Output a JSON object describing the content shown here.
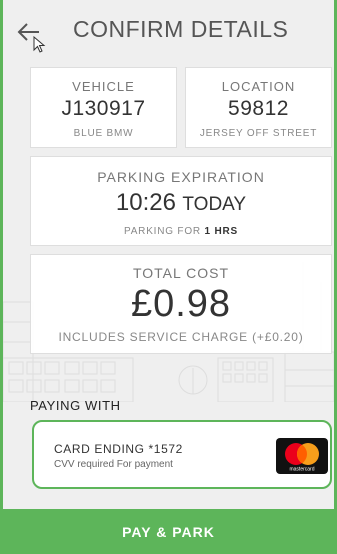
{
  "header": {
    "title": "CONFIRM DETAILS",
    "back_icon": "back-arrow-icon"
  },
  "vehicle": {
    "label": "VEHICLE",
    "plate": "J130917",
    "description": "BLUE BMW"
  },
  "location": {
    "label": "LOCATION",
    "code": "59812",
    "name": "JERSEY OFF STREET"
  },
  "expiration": {
    "label": "PARKING EXPIRATION",
    "time": "10:26",
    "day": "TODAY",
    "duration_prefix": "PARKING FOR",
    "duration": "1 HRS"
  },
  "total": {
    "label": "TOTAL COST",
    "amount": "£0.98",
    "note": "INCLUDES SERVICE CHARGE (+£0.20)"
  },
  "payment": {
    "section_label": "PAYING WITH",
    "card_ending": "CARD ENDING *1572",
    "cvv_note": "CVV required For payment",
    "card_brand_icon": "mastercard-icon",
    "brand_text": "mastercard"
  },
  "action": {
    "pay_label": "PAY & PARK"
  },
  "colors": {
    "accent": "#5db55a",
    "background": "#efefef",
    "text": "#333333"
  }
}
